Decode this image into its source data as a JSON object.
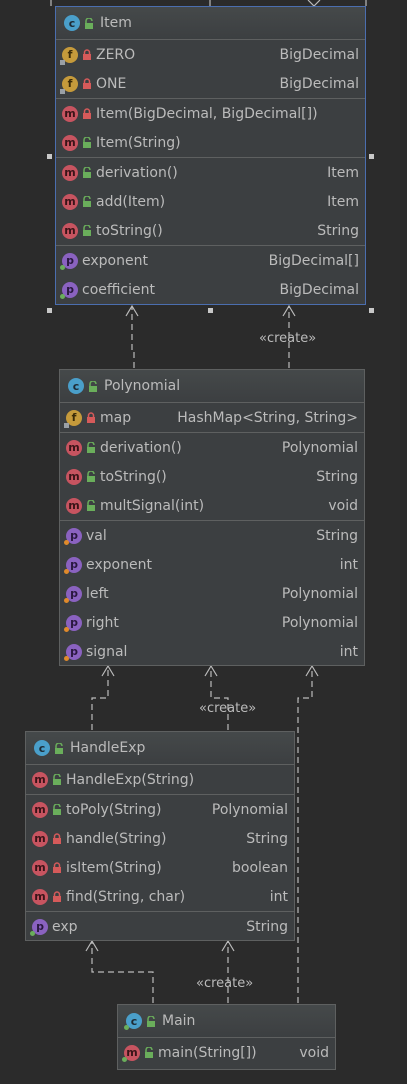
{
  "classes": {
    "item": {
      "name": "Item",
      "icon": "class-icon",
      "fields": [
        {
          "name": "ZERO",
          "type": "BigDecimal",
          "icon": "field-icon",
          "visibility": "private"
        },
        {
          "name": "ONE",
          "type": "BigDecimal",
          "icon": "field-icon",
          "visibility": "private"
        }
      ],
      "constructors": [
        {
          "name": "Item(BigDecimal, BigDecimal[])",
          "type": "",
          "icon": "method-icon",
          "visibility": "private"
        },
        {
          "name": "Item(String)",
          "type": "",
          "icon": "method-icon",
          "visibility": "public"
        }
      ],
      "methods": [
        {
          "name": "derivation()",
          "type": "Item",
          "icon": "method-icon",
          "visibility": "public"
        },
        {
          "name": "add(Item)",
          "type": "Item",
          "icon": "method-icon",
          "visibility": "public"
        },
        {
          "name": "toString()",
          "type": "String",
          "icon": "method-icon",
          "visibility": "public"
        }
      ],
      "properties": [
        {
          "name": "exponent",
          "type": "BigDecimal[]",
          "icon": "property-icon"
        },
        {
          "name": "coefficient",
          "type": "BigDecimal",
          "icon": "property-icon"
        }
      ]
    },
    "polynomial": {
      "name": "Polynomial",
      "icon": "class-icon",
      "fields": [
        {
          "name": "map",
          "type": "HashMap<String, String>",
          "icon": "field-icon",
          "visibility": "private"
        }
      ],
      "methods": [
        {
          "name": "derivation()",
          "type": "Polynomial",
          "icon": "method-icon",
          "visibility": "public"
        },
        {
          "name": "toString()",
          "type": "String",
          "icon": "method-icon",
          "visibility": "public"
        },
        {
          "name": "multSignal(int)",
          "type": "void",
          "icon": "method-icon",
          "visibility": "public"
        }
      ],
      "properties": [
        {
          "name": "val",
          "type": "String",
          "icon": "property-icon"
        },
        {
          "name": "exponent",
          "type": "int",
          "icon": "property-icon"
        },
        {
          "name": "left",
          "type": "Polynomial",
          "icon": "property-icon"
        },
        {
          "name": "right",
          "type": "Polynomial",
          "icon": "property-icon"
        },
        {
          "name": "signal",
          "type": "int",
          "icon": "property-icon"
        }
      ]
    },
    "handleexp": {
      "name": "HandleExp",
      "icon": "class-icon",
      "constructors": [
        {
          "name": "HandleExp(String)",
          "type": "",
          "icon": "method-icon",
          "visibility": "public"
        }
      ],
      "methods": [
        {
          "name": "toPoly(String)",
          "type": "Polynomial",
          "icon": "method-icon",
          "visibility": "public"
        },
        {
          "name": "handle(String)",
          "type": "String",
          "icon": "method-icon",
          "visibility": "private"
        },
        {
          "name": "isItem(String)",
          "type": "boolean",
          "icon": "method-icon",
          "visibility": "private"
        },
        {
          "name": "find(String, char)",
          "type": "int",
          "icon": "method-icon",
          "visibility": "private"
        }
      ],
      "properties": [
        {
          "name": "exp",
          "type": "String",
          "icon": "property-icon"
        }
      ]
    },
    "main": {
      "name": "Main",
      "icon": "class-icon",
      "methods": [
        {
          "name": "main(String[])",
          "type": "void",
          "icon": "method-icon",
          "visibility": "public"
        }
      ]
    }
  },
  "link_labels": {
    "create_1": "«create»",
    "create_2": "«create»",
    "create_3": "«create»"
  },
  "colors": {
    "background": "#2b2b2b",
    "box": "#3c3f41",
    "selection": "#4b6eaf",
    "arrow": "#bbbbbb"
  }
}
